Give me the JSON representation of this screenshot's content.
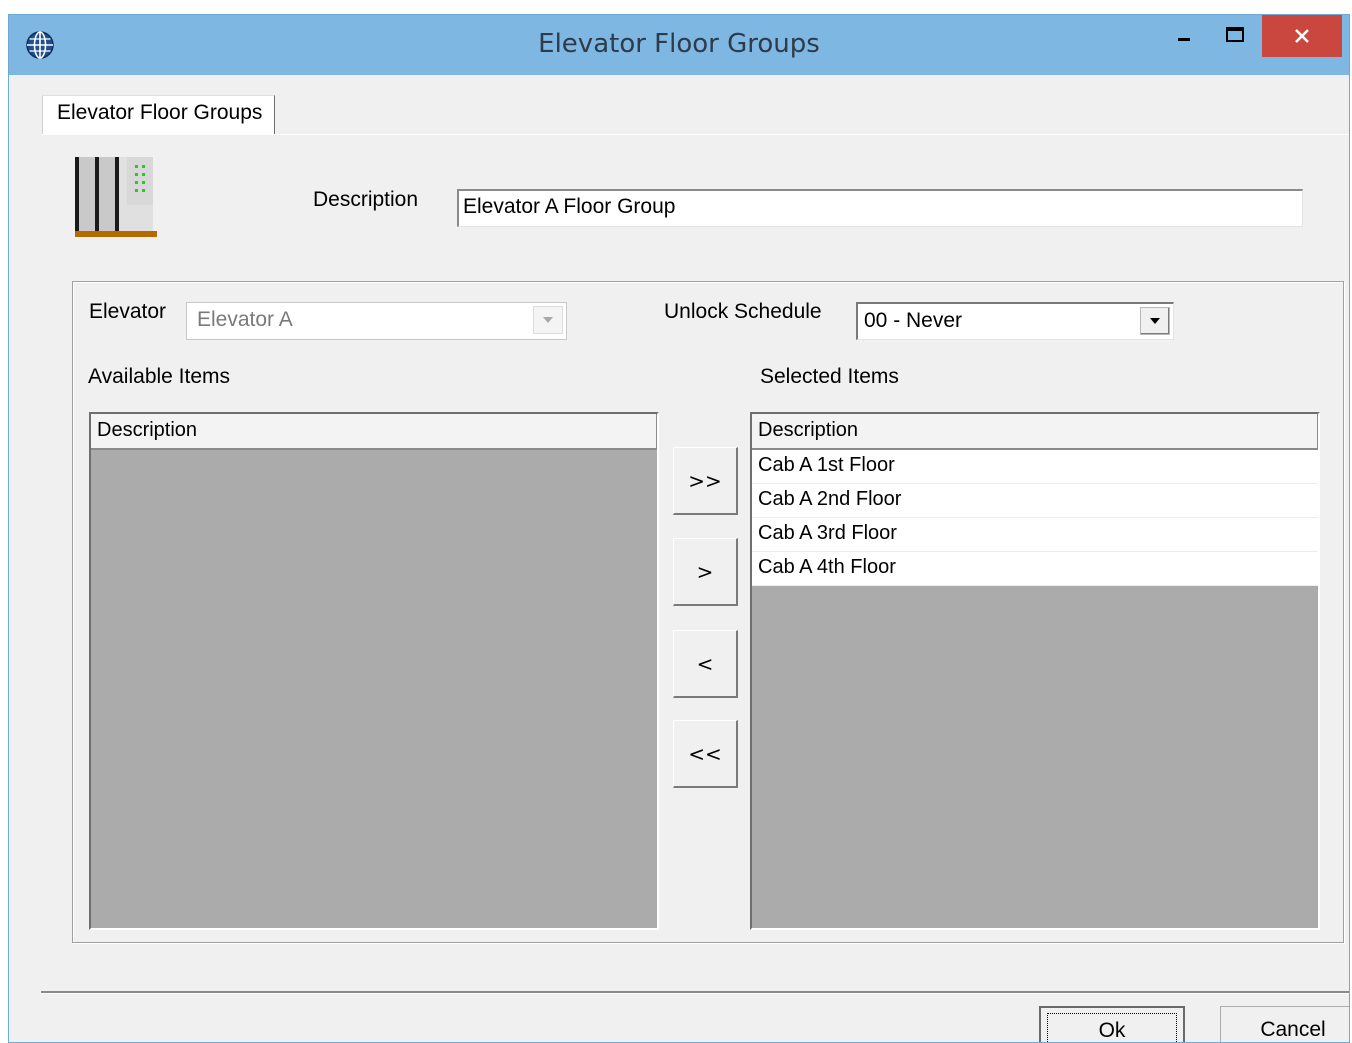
{
  "window": {
    "title": "Elevator Floor Groups",
    "icon": "globe-icon",
    "controls": [
      "minimize-icon",
      "maximize-icon",
      "close-icon"
    ],
    "close_color": "#c9473e",
    "titlebar_color": "#7eb7e2"
  },
  "tabs": [
    {
      "label": "Elevator Floor Groups",
      "active": true
    }
  ],
  "form": {
    "icon": "elevator-icon",
    "description_label": "Description",
    "description_value": "Elevator A Floor Group"
  },
  "group": {
    "elevator_label": "Elevator",
    "elevator_value": "Elevator A",
    "unlock_schedule_label": "Unlock Schedule",
    "unlock_schedule_value": "00 - Never",
    "available_label": "Available Items",
    "selected_label": "Selected Items",
    "available_list": {
      "header": "Description",
      "items": []
    },
    "selected_list": {
      "header": "Description",
      "items": [
        "Cab A 1st Floor",
        "Cab A 2nd Floor",
        "Cab A 3rd Floor",
        "Cab A 4th Floor"
      ]
    },
    "move_buttons": {
      "add_all": ">>",
      "add": ">",
      "remove": "<",
      "remove_all": "<<"
    }
  },
  "footer": {
    "ok_label": "Ok",
    "cancel_label": "Cancel"
  }
}
